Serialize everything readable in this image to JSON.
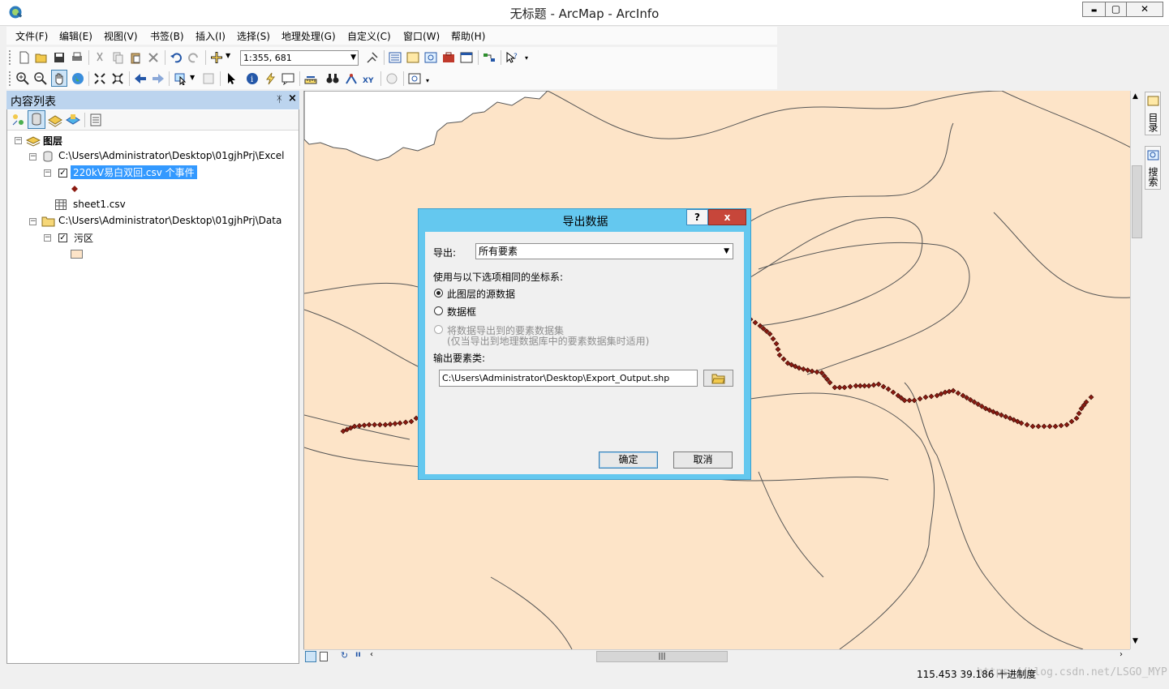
{
  "window": {
    "title": "无标题 - ArcMap - ArcInfo",
    "min_label": "▬",
    "max_label": "▢",
    "close_label": "✕"
  },
  "menu": [
    "文件(F)",
    "编辑(E)",
    "视图(V)",
    "书签(B)",
    "插入(I)",
    "选择(S)",
    "地理处理(G)",
    "自定义(C)",
    "窗口(W)",
    "帮助(H)"
  ],
  "toolbar": {
    "scale": "1:355, 681"
  },
  "toc": {
    "title": "内容列表",
    "pin": "ᛡ",
    "close": "×",
    "root": "图层",
    "groups": [
      {
        "path": "C:\\Users\\Administrator\\Desktop\\01gjhPrj\\Excel",
        "layer": "220kV易白双回.csv 个事件",
        "table": "sheet1.csv"
      },
      {
        "path": "C:\\Users\\Administrator\\Desktop\\01gjhPrj\\Data",
        "layer": "污区"
      }
    ]
  },
  "side_tabs": [
    "目录",
    "搜索"
  ],
  "status": {
    "coords": "115.453  39.186 十进制度",
    "watermark": "https://blog.csdn.net/LSGO_MYP"
  },
  "dialog": {
    "title": "导出数据",
    "help": "?",
    "close": "x",
    "export_label": "导出:",
    "export_value": "所有要素",
    "coord_label": "使用与以下选项相同的坐标系:",
    "radio1": "此图层的源数据",
    "radio2": "数据框",
    "radio3": "将数据导出到的要素数据集",
    "radio3_note": "(仅当导出到地理数据库中的要素数据集时适用)",
    "output_label": "输出要素类:",
    "output_value": "C:\\Users\\Administrator\\Desktop\\Export_Output.shp",
    "ok": "确定",
    "cancel": "取消"
  },
  "colors": {
    "map_fill": "#fde4c8",
    "dialog_frame": "#64c8ef",
    "point_color": "#8b1a10",
    "selected": "#3399ff"
  }
}
